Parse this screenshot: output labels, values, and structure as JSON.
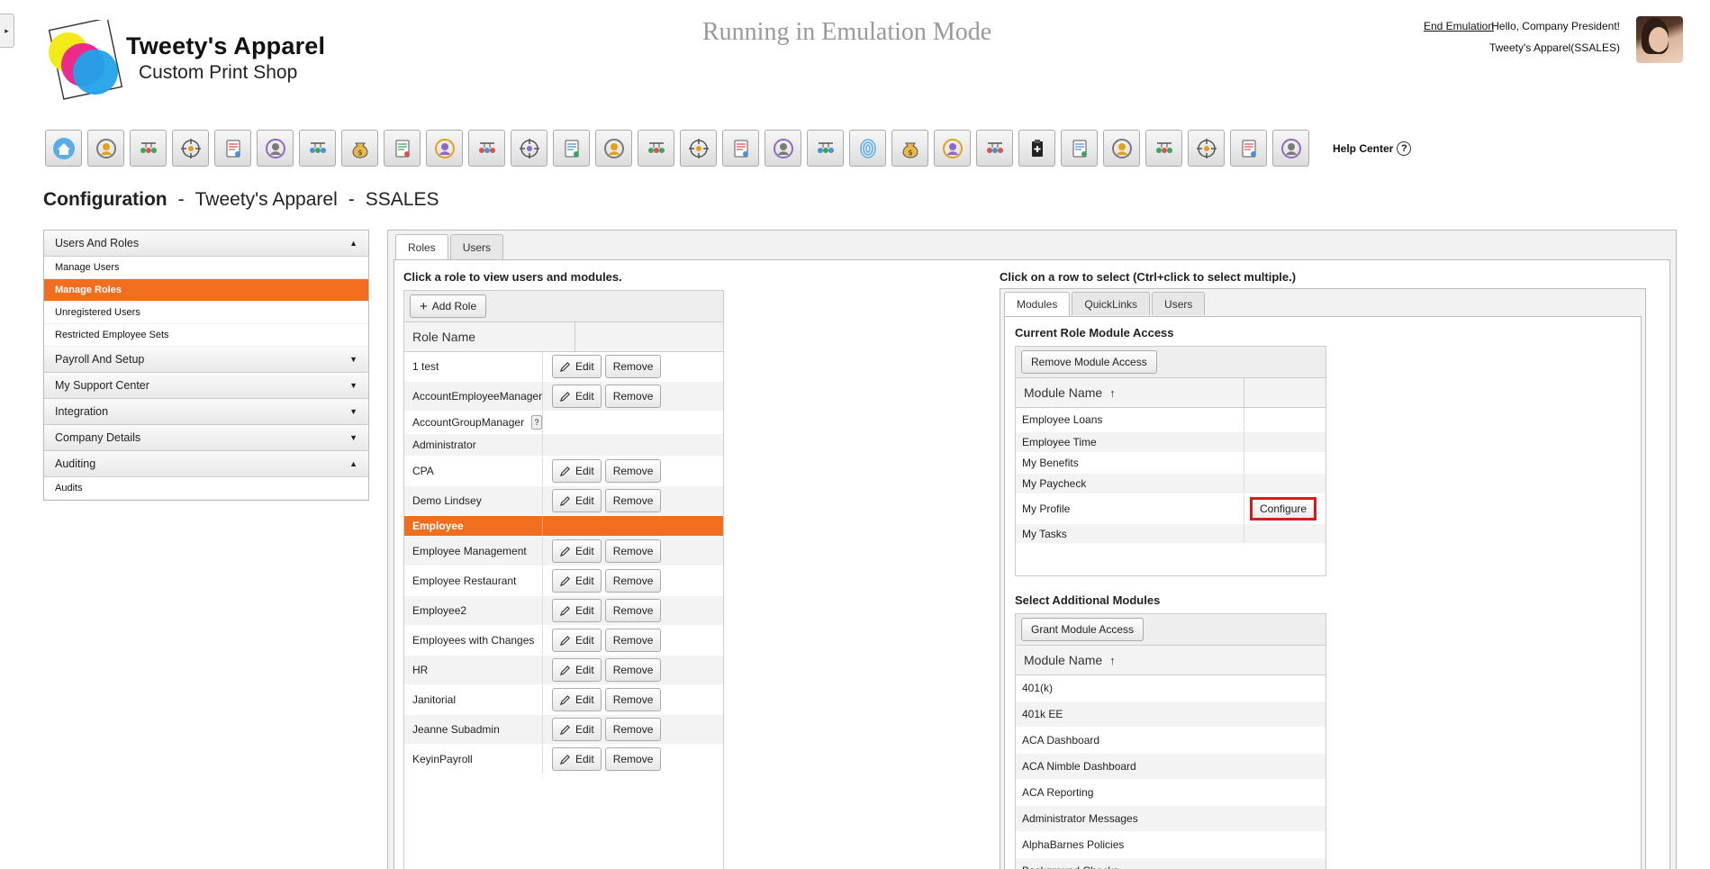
{
  "side_toggle": "▸",
  "logo": {
    "title": "Tweety's Apparel",
    "subtitle": "Custom Print Shop"
  },
  "emulation_banner": "Running in Emulation Mode",
  "user": {
    "end_emulation": "End Emulation",
    "greeting": "Hello, Company President!",
    "company": "Tweety's Apparel(SSALES)"
  },
  "toolbar": {
    "icons": [
      "home-icon",
      "employee-icon",
      "payroll-icon",
      "timeclock-icon",
      "people-icon",
      "org-chart-icon",
      "document-icon",
      "money-bag-icon",
      "search-person-icon",
      "target-icon",
      "target-alt-icon",
      "growth-icon",
      "crosshair-icon",
      "transfer-icon",
      "promote-icon",
      "shield-icon",
      "award-icon",
      "compare-icon",
      "broken-icon",
      "fingerprint-icon",
      "money-bag-alt-icon",
      "handshake-icon",
      "team-icon",
      "clipboard-icon",
      "shield-alt-icon",
      "key-icon",
      "gift-icon",
      "form-icon",
      "group-icon",
      "certificate-icon"
    ],
    "help_label": "Help Center",
    "help_glyph": "?"
  },
  "page_title": {
    "section": "Configuration",
    "company": "Tweety's Apparel",
    "code": "SSALES",
    "separator": "-"
  },
  "leftnav": {
    "sections": [
      {
        "label": "Users And Roles",
        "arrow": "▲",
        "items": [
          "Manage Users",
          "Manage Roles",
          "Unregistered Users",
          "Restricted Employee Sets"
        ]
      },
      {
        "label": "Payroll And Setup",
        "arrow": "▼",
        "items": []
      },
      {
        "label": "My Support Center",
        "arrow": "▼",
        "items": []
      },
      {
        "label": "Integration",
        "arrow": "▼",
        "items": []
      },
      {
        "label": "Company Details",
        "arrow": "▼",
        "items": []
      },
      {
        "label": "Auditing",
        "arrow": "▲",
        "items": [
          "Audits"
        ]
      }
    ],
    "active_item": "Manage Roles"
  },
  "main_tabs": [
    "Roles",
    "Users"
  ],
  "roles": {
    "hint": "Click a role to view users and modules.",
    "add_label": "Add Role",
    "add_glyph": "+",
    "column": "Role Name",
    "edit_label": "Edit",
    "remove_label": "Remove",
    "help_glyph": "?",
    "selected": "Employee",
    "rows": [
      {
        "name": "1 test",
        "actions": true
      },
      {
        "name": "AccountEmployeeManager",
        "actions": true
      },
      {
        "name": "AccountGroupManager",
        "actions": false,
        "help": true
      },
      {
        "name": "Administrator",
        "actions": false
      },
      {
        "name": "CPA",
        "actions": true
      },
      {
        "name": "Demo Lindsey",
        "actions": true
      },
      {
        "name": "Employee",
        "actions": false
      },
      {
        "name": "Employee Management",
        "actions": true
      },
      {
        "name": "Employee Restaurant",
        "actions": true
      },
      {
        "name": "Employee2",
        "actions": true
      },
      {
        "name": "Employees with Changes",
        "actions": true
      },
      {
        "name": "HR",
        "actions": true
      },
      {
        "name": "Janitorial",
        "actions": true
      },
      {
        "name": "Jeanne Subadmin",
        "actions": true
      },
      {
        "name": "KeyinPayroll",
        "actions": true
      }
    ]
  },
  "modules": {
    "hint": "Click on a row to select (Ctrl+click to select multiple.)",
    "tabs": [
      "Modules",
      "QuickLinks",
      "Users"
    ],
    "current_title": "Current Role Module Access",
    "remove_label": "Remove Module Access",
    "column": "Module Name",
    "sort_glyph": "↑",
    "configure_label": "Configure",
    "current_rows": [
      "Employee Loans",
      "Employee Time",
      "My Benefits",
      "My Paycheck",
      "My Profile",
      "My Tasks"
    ],
    "configure_row": "My Profile",
    "additional_title": "Select Additional Modules",
    "grant_label": "Grant Module Access",
    "additional_rows": [
      "401(k)",
      "401k EE",
      "ACA Dashboard",
      "ACA Nimble Dashboard",
      "ACA Reporting",
      "Administrator Messages",
      "AlphaBarnes Policies",
      "Background Checks"
    ]
  }
}
